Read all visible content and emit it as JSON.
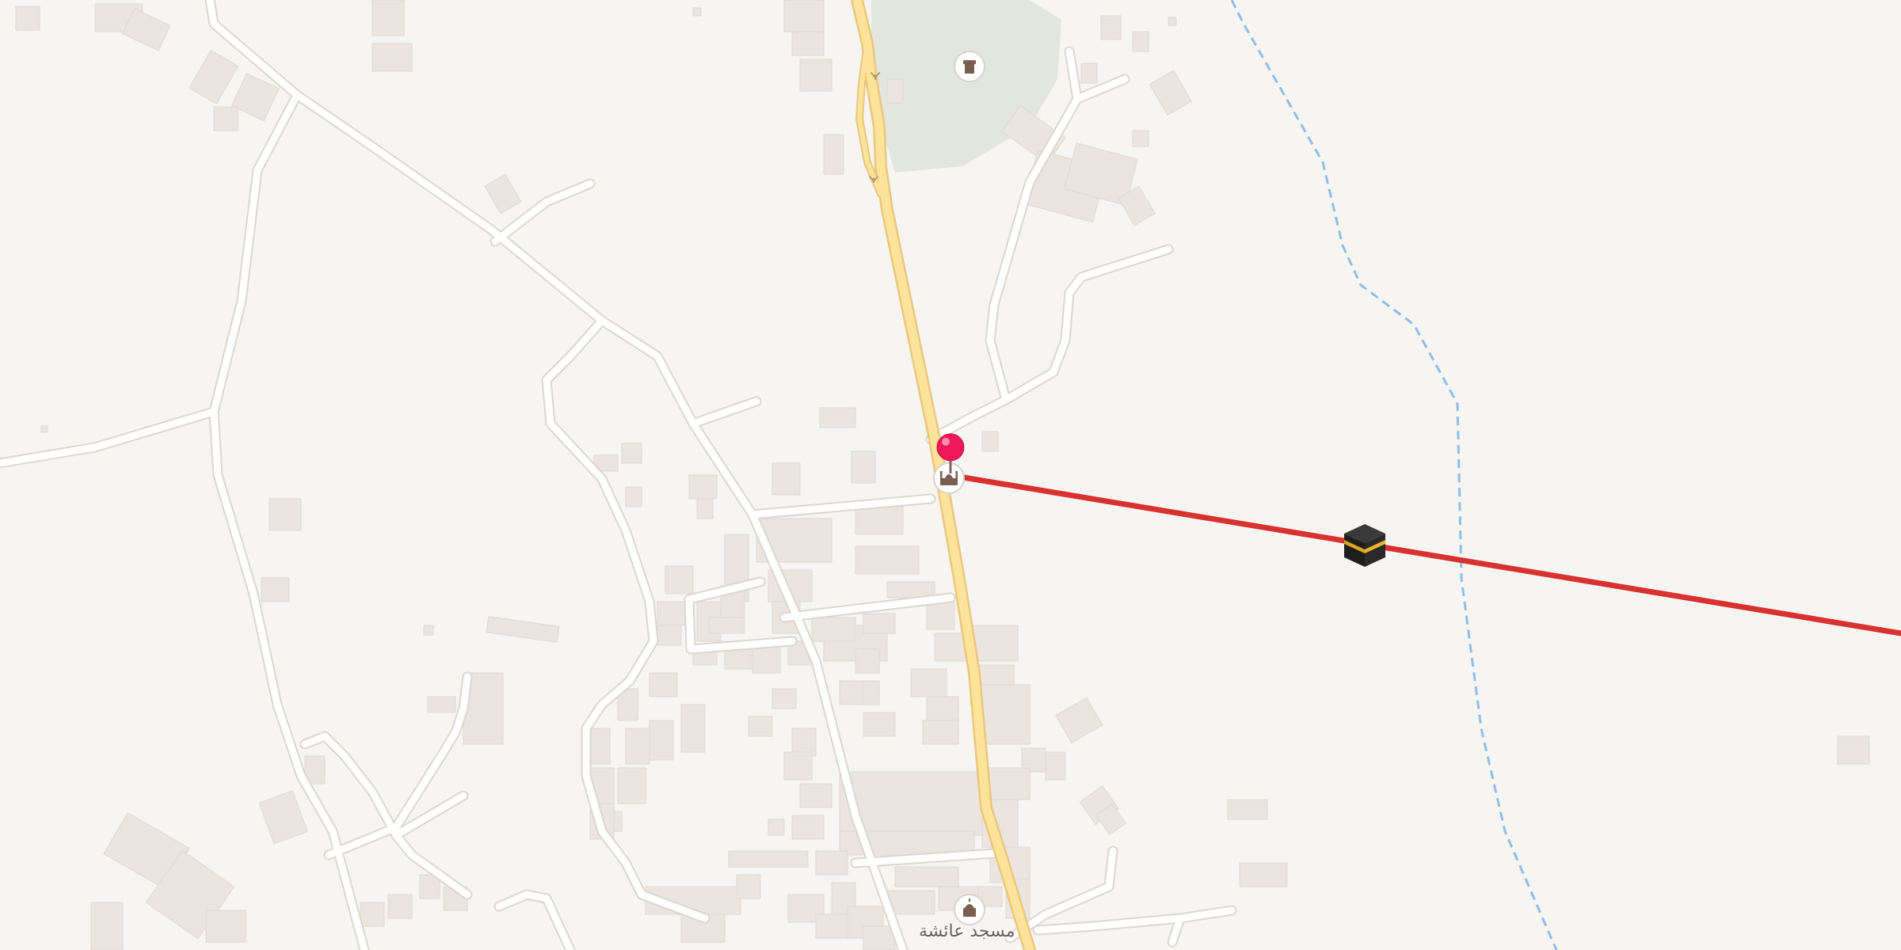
{
  "map": {
    "background_color": "#f7f5f2",
    "road_color": "#ffffff",
    "highway_color": "#fde39a",
    "highway_casing_color": "#e9c77d",
    "building_color": "#ebe5df",
    "park_color": "#e2e6df",
    "boundary_color": "#90bde6",
    "qibla_line_color": "#d93030",
    "pin_color": "#f0185a"
  },
  "pois": [
    {
      "name": "mosque-aisha",
      "label": "مسجد عائشة",
      "icon": "mosque-icon"
    },
    {
      "name": "mosque-at-pin",
      "label": "",
      "icon": "mosque-icon"
    },
    {
      "name": "cemetery",
      "label": "",
      "icon": "cemetery-icon"
    }
  ],
  "markers": {
    "location_pin": "location-pin-icon",
    "kaaba": "kaaba-icon"
  }
}
